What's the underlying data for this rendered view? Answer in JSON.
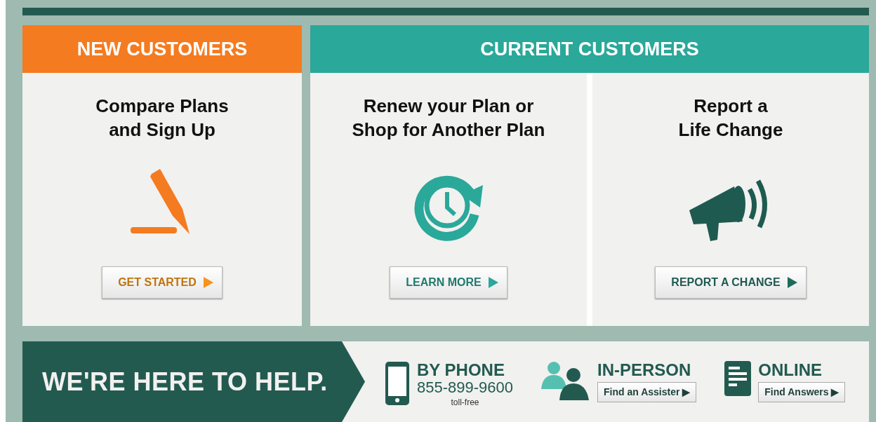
{
  "sections": [
    {
      "heading": "NEW CUSTOMERS",
      "color": "#f47b20",
      "cards": [
        {
          "lines": [
            "Compare Plans",
            "and Sign Up"
          ],
          "button": "GET STARTED"
        }
      ]
    },
    {
      "heading": "CURRENT CUSTOMERS",
      "color": "#2aa89a",
      "cards": [
        {
          "lines": [
            "Renew your Plan or",
            "Shop for Another Plan"
          ],
          "button": "LEARN MORE"
        },
        {
          "lines": [
            "Report a",
            "Life Change"
          ],
          "button": "REPORT A CHANGE"
        }
      ]
    }
  ],
  "help": {
    "banner": "WE'RE HERE TO HELP.",
    "items": [
      {
        "kind": "phone",
        "heading": "BY PHONE",
        "number": "855-899-9600",
        "note": "toll-free"
      },
      {
        "kind": "person",
        "heading": "IN-PERSON",
        "button": "Find an Assister ▶"
      },
      {
        "kind": "online",
        "heading": "ONLINE",
        "button": "Find Answers ▶"
      }
    ]
  }
}
